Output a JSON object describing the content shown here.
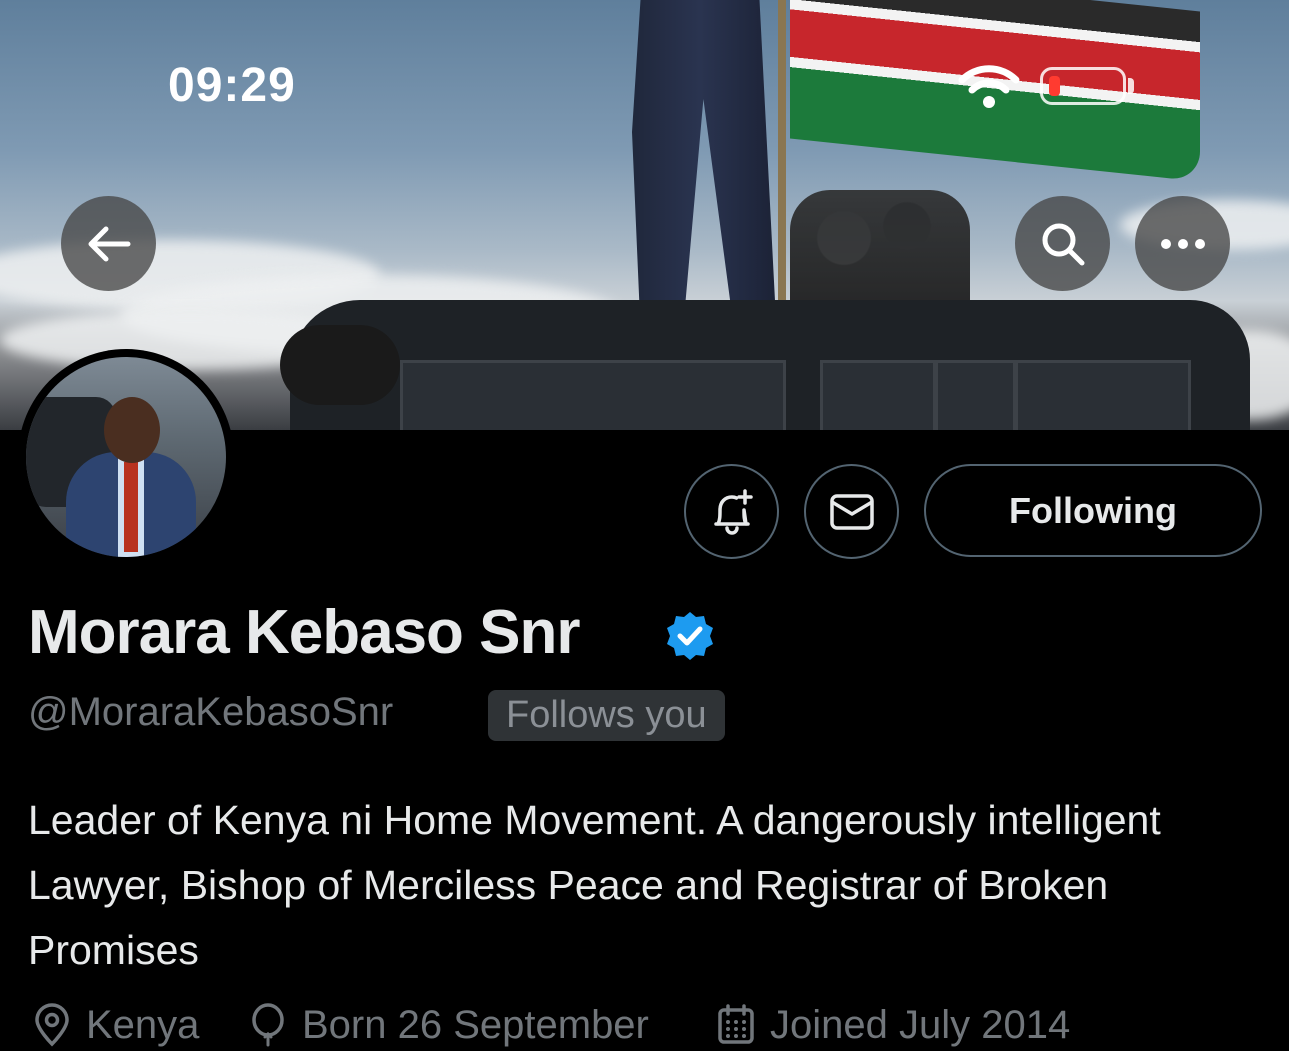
{
  "status_bar": {
    "time": "09:29"
  },
  "header": {
    "back_icon": "arrow-left-icon",
    "search_icon": "search-icon",
    "more_icon": "more-horizontal-icon"
  },
  "actions": {
    "notify_icon": "bell-plus-icon",
    "message_icon": "mail-icon",
    "following_label": "Following"
  },
  "profile": {
    "display_name": "Morara Kebaso Snr",
    "verified": true,
    "handle": "@MoraraKebasoSnr",
    "follows_you": "Follows you",
    "bio": "Leader of Kenya ni Home Movement. A dangerously intelligent Lawyer, Bishop of Merciless Peace and Registrar of Broken Promises",
    "location": "Kenya",
    "birthday": "Born 26 September",
    "joined": "Joined July 2014"
  },
  "colors": {
    "background": "#000000",
    "text_primary": "#e7e9ea",
    "text_secondary": "#71767b",
    "verified_blue": "#1d9bf0",
    "battery_low": "#ff3b30"
  }
}
